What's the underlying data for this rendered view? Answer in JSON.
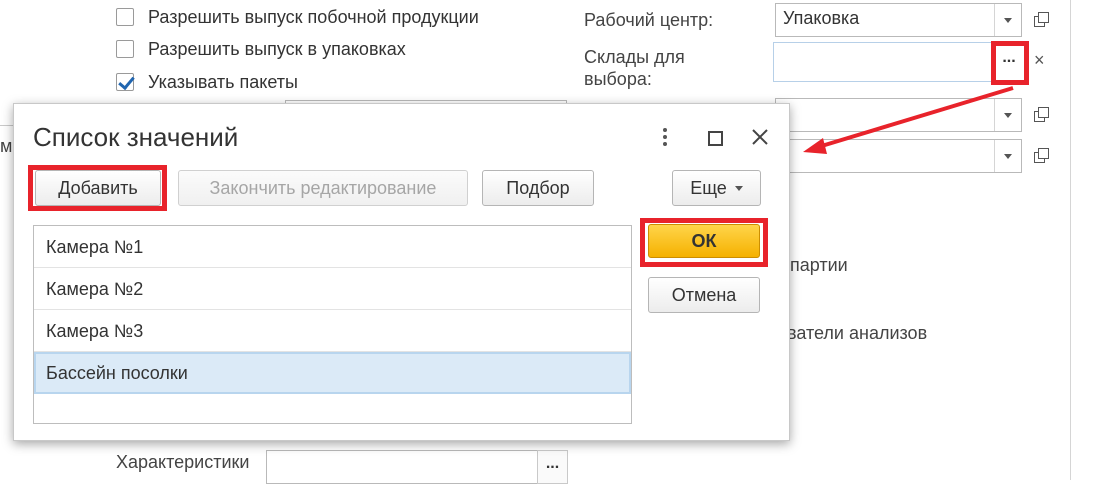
{
  "background": {
    "checkboxes": [
      {
        "label": "Разрешить выпуск побочной продукции",
        "checked": false
      },
      {
        "label": "Разрешить выпуск в упаковках",
        "checked": false
      },
      {
        "label": "Указывать пакеты",
        "checked": true
      }
    ],
    "work_center_label": "Рабочий центр:",
    "work_center_value": "Упаковка",
    "warehouses_label": "Склады для выбора:",
    "warehouses_select_button": "...",
    "warehouses_clear": "×",
    "partial_text_1": "партии",
    "partial_text_2": "ватели анализов",
    "partial_left": "ма",
    "characteristics_label": "Характеристики",
    "characteristics_select_button": "..."
  },
  "dialog": {
    "title": "Список значений",
    "toolbar": {
      "add": "Добавить",
      "finish_editing": "Закончить редактирование",
      "pick": "Подбор",
      "more": "Еще"
    },
    "items": [
      "Камера №1",
      "Камера №2",
      "Камера №3",
      "Бассейн посолки"
    ],
    "selected_index": 3,
    "ok": "ОК",
    "cancel": "Отмена"
  },
  "colors": {
    "highlight": "#e8232b",
    "ok_button": "#f5b100",
    "selection": "#dbeaf7",
    "check": "#2166b0"
  }
}
